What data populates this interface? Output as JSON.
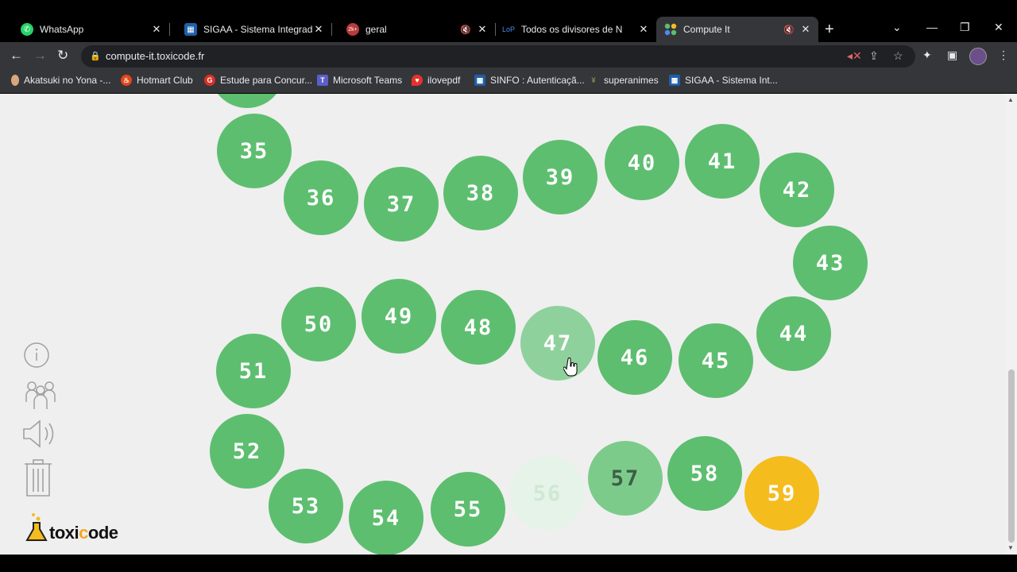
{
  "tabs": [
    {
      "title": "WhatsApp",
      "favicon": "whatsapp-icon",
      "color": "#25d366"
    },
    {
      "title": "SIGAA - Sistema Integrado d",
      "favicon": "sigaa-icon",
      "color": "#1e5fa8"
    },
    {
      "title": "geral",
      "favicon": "discord-icon",
      "color": "#b83a3a",
      "badge": "2k+",
      "muted": true
    },
    {
      "title": "Todos os divisores de N",
      "favicon": "lop-icon",
      "color": "#1a73e8",
      "fav_text": "LoP"
    },
    {
      "title": "Compute It",
      "favicon": "compute-it-icon",
      "color": "#5dbe6f",
      "muted": true,
      "active": true
    }
  ],
  "address_bar": {
    "url": "compute-it.toxicode.fr"
  },
  "bookmarks": [
    {
      "label": "Akatsuki no Yona -...",
      "icon": "akatsuki-icon",
      "color": "#d9a77d"
    },
    {
      "label": "Hotmart Club",
      "icon": "hotmart-icon",
      "color": "#e2461b"
    },
    {
      "label": "Estude para Concur...",
      "icon": "estude-icon",
      "color": "#d93025",
      "fav_text": "G"
    },
    {
      "label": "Microsoft Teams",
      "icon": "teams-icon",
      "color": "#5b5fc7"
    },
    {
      "label": "ilovepdf",
      "icon": "ilovepdf-icon",
      "color": "#e5322d"
    },
    {
      "label": "SINFO : Autenticaçã...",
      "icon": "sinfo-icon",
      "color": "#1e5fa8"
    },
    {
      "label": "superanimes",
      "icon": "superanimes-icon",
      "color": "#8a8a5a"
    },
    {
      "label": "SIGAA - Sistema Int...",
      "icon": "sigaa-icon",
      "color": "#1e5fa8"
    }
  ],
  "game": {
    "circles": [
      {
        "number": "35",
        "state": "done"
      },
      {
        "number": "36",
        "state": "done"
      },
      {
        "number": "37",
        "state": "done"
      },
      {
        "number": "38",
        "state": "done"
      },
      {
        "number": "39",
        "state": "done"
      },
      {
        "number": "40",
        "state": "done"
      },
      {
        "number": "41",
        "state": "done"
      },
      {
        "number": "42",
        "state": "done"
      },
      {
        "number": "43",
        "state": "done"
      },
      {
        "number": "44",
        "state": "done"
      },
      {
        "number": "45",
        "state": "done"
      },
      {
        "number": "46",
        "state": "done"
      },
      {
        "number": "47",
        "state": "hover"
      },
      {
        "number": "48",
        "state": "done"
      },
      {
        "number": "49",
        "state": "done"
      },
      {
        "number": "50",
        "state": "done"
      },
      {
        "number": "51",
        "state": "done"
      },
      {
        "number": "52",
        "state": "done"
      },
      {
        "number": "53",
        "state": "done"
      },
      {
        "number": "54",
        "state": "done"
      },
      {
        "number": "55",
        "state": "done"
      },
      {
        "number": "56",
        "state": "faded"
      },
      {
        "number": "57",
        "state": "partial"
      },
      {
        "number": "58",
        "state": "done"
      },
      {
        "number": "59",
        "state": "current"
      }
    ],
    "colors": {
      "done": "#5dbe6f",
      "hover": "#8fd19c",
      "current": "#f5bc1e"
    }
  },
  "sidebar": {
    "icons": [
      "info-icon",
      "players-icon",
      "sound-icon",
      "trash-icon"
    ]
  },
  "logo": {
    "text_a": "toxi",
    "text_b": "c",
    "text_c": "ode"
  }
}
